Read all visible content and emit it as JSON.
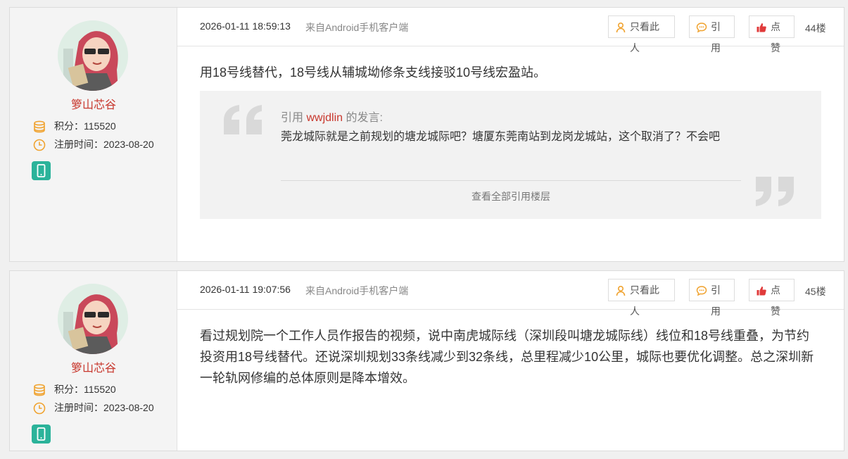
{
  "posts": [
    {
      "author": "箩山芯谷",
      "points_label": "积分：",
      "points": "115520",
      "reg_label": "注册时间：",
      "reg_date": "2023-08-20",
      "time": "2026-01-11 18:59:13",
      "client": "来自Android手机客户端",
      "only_label": "只看此人",
      "quote_label": "引用",
      "like_label": "点赞",
      "floor": "44楼",
      "content": "用18号线替代，18号线从辅城坳修条支线接驳10号线宏盈站。",
      "quote": {
        "prefix": "引用",
        "user": "wwjdlin",
        "suffix": "的发言:",
        "text": "莞龙城际就是之前规划的塘龙城际吧？塘厦东莞南站到龙岗龙城站，这个取消了？不会吧",
        "more": "查看全部引用楼层"
      }
    },
    {
      "author": "箩山芯谷",
      "points_label": "积分：",
      "points": "115520",
      "reg_label": "注册时间：",
      "reg_date": "2023-08-20",
      "time": "2026-01-11 19:07:56",
      "client": "来自Android手机客户端",
      "only_label": "只看此人",
      "quote_label": "引用",
      "like_label": "点赞",
      "floor": "45楼",
      "content": "看过规划院一个工作人员作报告的视频，说中南虎城际线（深圳段叫塘龙城际线）线位和18号线重叠，为节约投资用18号线替代。还说深圳规划33条线减少到32条线，总里程减少10公里，城际也要优化调整。总之深圳新一轮轨网修编的总体原则是降本增效。"
    }
  ],
  "colors": {
    "accent": "#c8372d",
    "icon_orange": "#f0a330",
    "device_green": "#2bb39a"
  },
  "icons": [
    "coins-icon",
    "clock-icon",
    "mobile-device-icon",
    "person-icon",
    "quote-bubble-icon",
    "thumbs-up-icon",
    "open-quote-icon",
    "close-quote-icon"
  ]
}
